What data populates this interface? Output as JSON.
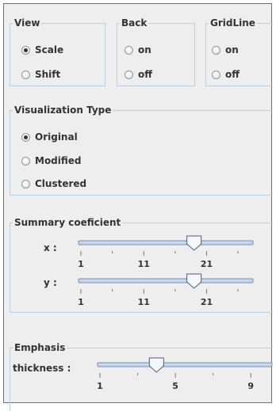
{
  "view": {
    "title": "View",
    "options": [
      {
        "label": "Scale",
        "checked": true
      },
      {
        "label": "Shift",
        "checked": false
      }
    ]
  },
  "back": {
    "title": "Back",
    "options": [
      {
        "label": "on",
        "checked": false
      },
      {
        "label": "off",
        "checked": false
      }
    ]
  },
  "gridline": {
    "title": "GridLine",
    "options": [
      {
        "label": "on",
        "checked": false
      },
      {
        "label": "off",
        "checked": false
      }
    ]
  },
  "visualization": {
    "title": "Visualization Type",
    "options": [
      {
        "label": "Original",
        "checked": true
      },
      {
        "label": "Modified",
        "checked": false
      },
      {
        "label": "Clustered",
        "checked": false
      }
    ]
  },
  "summary": {
    "title": "Summary coeficient",
    "x": {
      "label": "x :",
      "min": 1,
      "max": 28,
      "value": 19,
      "tick_labels": [
        "1",
        "11",
        "21"
      ]
    },
    "y": {
      "label": "y :",
      "min": 1,
      "max": 28,
      "value": 19,
      "tick_labels": [
        "1",
        "11",
        "21"
      ]
    }
  },
  "emphasis": {
    "title": "Emphasis",
    "thickness": {
      "label": "thickness :",
      "min": 1,
      "max": 10,
      "value": 4,
      "tick_labels": [
        "1",
        "5",
        "9"
      ]
    }
  },
  "colors": {
    "panel_bg": "#eeeeee",
    "group_border": "#b8cfe5",
    "track_fill": "#c6d8ec",
    "thumb_fill": "#f4f8fc",
    "text": "#333333"
  }
}
